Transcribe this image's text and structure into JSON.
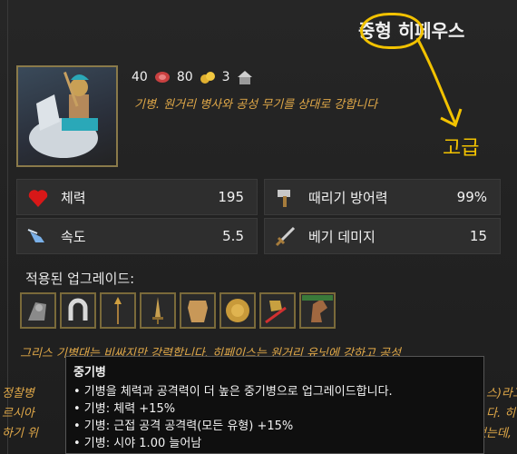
{
  "unit": {
    "title_prefix": "중형",
    "title_name": "히페우스",
    "cost_food": "40",
    "cost_gold": "80",
    "pop": "3",
    "description": "기병. 원거리 병사와 공성 무기를 상대로 강합니다"
  },
  "annotation": {
    "text": "고급",
    "color": "#f2c200"
  },
  "stats": [
    {
      "label": "체력",
      "value": "195",
      "icon": "heart-icon"
    },
    {
      "label": "때리기 방어력",
      "value": "99%",
      "icon": "hammer-icon"
    },
    {
      "label": "속도",
      "value": "5.5",
      "icon": "winged-foot-icon"
    },
    {
      "label": "베기 데미지",
      "value": "15",
      "icon": "sword-icon"
    }
  ],
  "upgrades": {
    "title": "적용된 업그레이드:",
    "items": [
      "armored-horse-icon",
      "horseshoe-icon",
      "spear-icon",
      "sword-upgrade-icon",
      "armor-icon",
      "shield-icon",
      "helmet-blade-icon",
      "horse-head-icon"
    ]
  },
  "lore": {
    "line1": "그리스 기병대는 비싸지만 강력합니다. 히페이스는 원거리 유닛에 강하고 공성",
    "line2a": "정찰병",
    "line2b": "스)라고",
    "line3a": "르시아",
    "line3b": "다. 히",
    "line4a": "하기 위",
    "line4b": "나타냈는데,"
  },
  "tooltip": {
    "title": "중기병",
    "lines": [
      "• 기병을 체력과 공격력이 더 높은 중기병으로 업그레이드합니다.",
      "• 기병: 체력 +15%",
      "• 기병: 근접 공격 공격력(모든 유형) +15%",
      "• 기병: 시야 1.00 늘어남"
    ]
  }
}
